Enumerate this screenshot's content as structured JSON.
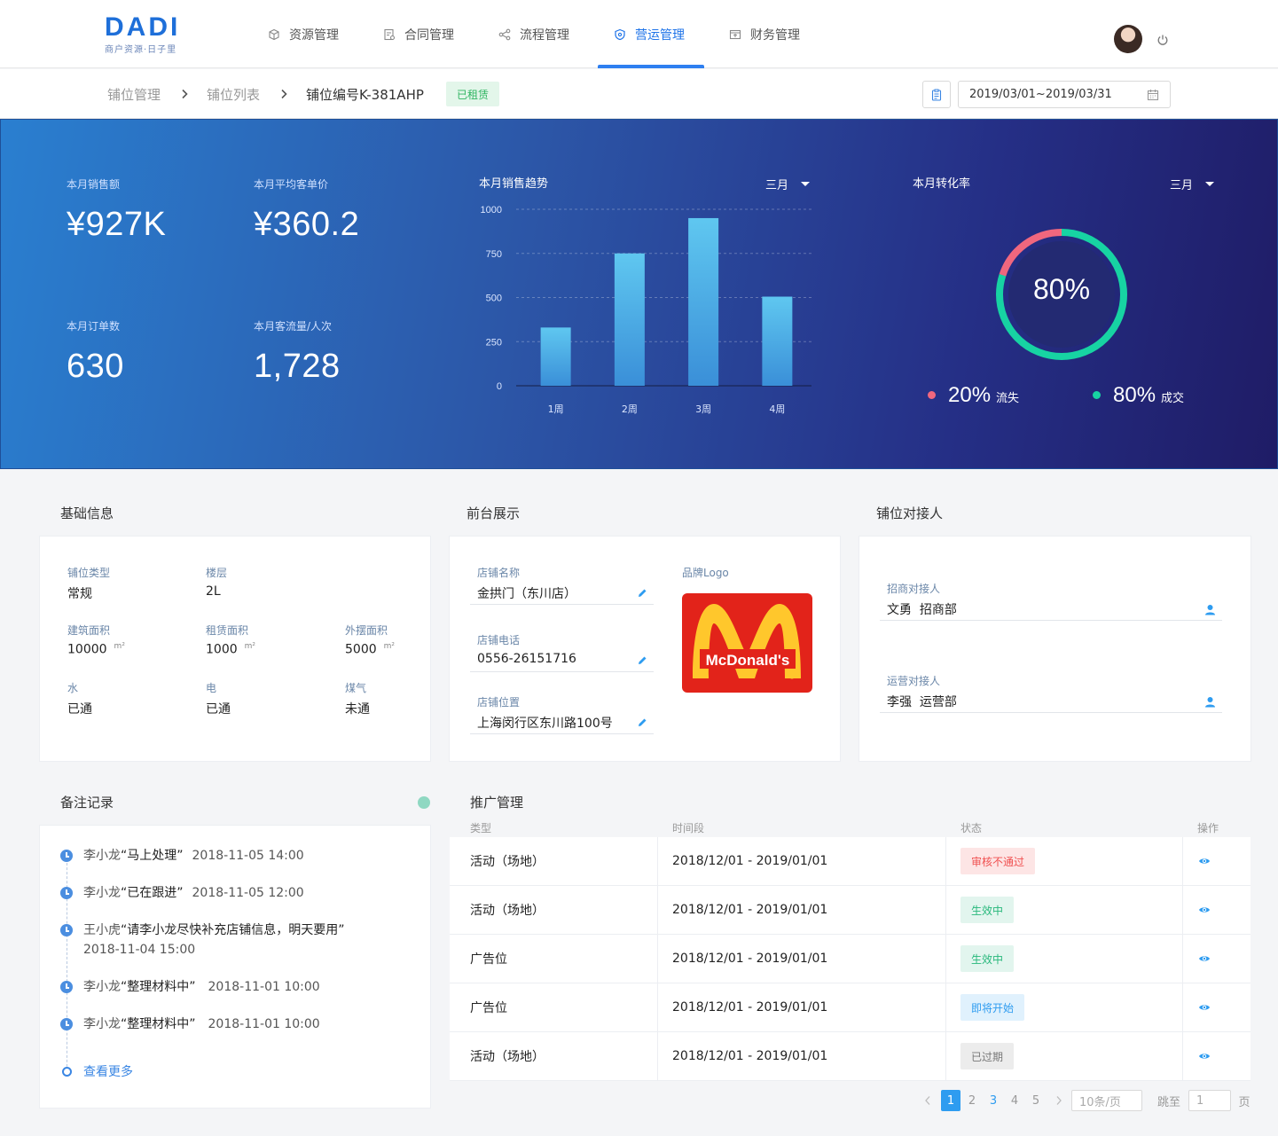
{
  "brand": {
    "logo": "DADI",
    "tagline": "商户资源·日子里"
  },
  "nav": {
    "items": [
      {
        "label": "资源管理",
        "icon": "box-icon"
      },
      {
        "label": "合同管理",
        "icon": "contract-icon"
      },
      {
        "label": "流程管理",
        "icon": "flow-icon"
      },
      {
        "label": "营运管理",
        "icon": "operations-icon",
        "active": true
      },
      {
        "label": "财务管理",
        "icon": "finance-icon"
      }
    ]
  },
  "breadcrumb": {
    "items": [
      "铺位管理",
      "铺位列表",
      "铺位编号K-381AHP"
    ],
    "status_tag": "已租赁"
  },
  "date_range": {
    "value": "2019/03/01~2019/03/31"
  },
  "kpis": [
    {
      "label": "本月销售额",
      "value": "¥927K"
    },
    {
      "label": "本月平均客单价",
      "value": "¥360.2"
    },
    {
      "label": "本月订单数",
      "value": "630"
    },
    {
      "label": "本月客流量/人次",
      "value": "1,728"
    }
  ],
  "sales_trend": {
    "title": "本月销售趋势",
    "period": "三月"
  },
  "conversion": {
    "title": "本月转化率",
    "period": "三月",
    "center_label": "80%",
    "legend": [
      {
        "pct": "20%",
        "name": "流失",
        "color": "#f0677e"
      },
      {
        "pct": "80%",
        "name": "成交",
        "color": "#17d3a3"
      }
    ],
    "value": 0.8
  },
  "chart_data": {
    "type": "bar",
    "categories": [
      "1周",
      "2周",
      "3周",
      "4周"
    ],
    "values": [
      330,
      750,
      950,
      505
    ],
    "ylim": [
      0,
      1000
    ],
    "yticks": [
      0,
      250,
      500,
      750,
      1000
    ],
    "grid": true
  },
  "basic_info": {
    "title": "基础信息",
    "fields": [
      {
        "label": "铺位类型",
        "value": "常规"
      },
      {
        "label": "楼层",
        "value": "2L"
      },
      {
        "label": "建筑面积",
        "value": "10000",
        "unit": "m²"
      },
      {
        "label": "租赁面积",
        "value": "1000",
        "unit": "m²"
      },
      {
        "label": "外摆面积",
        "value": "5000",
        "unit": "m²"
      },
      {
        "label": "水",
        "value": "已通"
      },
      {
        "label": "电",
        "value": "已通"
      },
      {
        "label": "煤气",
        "value": "未通"
      }
    ]
  },
  "storefront": {
    "title": "前台展示",
    "fields": [
      {
        "label": "店铺名称",
        "value": "金拱门（东川店）"
      },
      {
        "label": "店铺电话",
        "value": "0556-26151716"
      },
      {
        "label": "店铺位置",
        "value": "上海闵行区东川路100号"
      }
    ],
    "logo_label": "品牌Logo",
    "logo_text": "McDonald's"
  },
  "contacts": {
    "title": "铺位对接人",
    "fields": [
      {
        "label": "招商对接人",
        "value": "文勇  招商部"
      },
      {
        "label": "运营对接人",
        "value": "李强  运营部"
      }
    ]
  },
  "notes": {
    "title": "备注记录",
    "items": [
      {
        "who": "李小龙",
        "quote": "“马上处理”",
        "time": "2018-11-05 14:00"
      },
      {
        "who": "李小龙",
        "quote": "“已在跟进”",
        "time": "2018-11-05 12:00"
      },
      {
        "who": "王小虎",
        "quote": "“请李小龙尽快补充店铺信息，明天要用”",
        "time": "2018-11-04 15:00"
      },
      {
        "who": "李小龙",
        "quote": "“整理材料中”",
        "time": "2018-11-01 10:00"
      },
      {
        "who": "李小龙",
        "quote": "“整理材料中”",
        "time": "2018-11-01 10:00"
      }
    ],
    "more": "查看更多"
  },
  "promotion": {
    "title": "推广管理",
    "columns": [
      "类型",
      "时间段",
      "状态",
      "操作"
    ],
    "rows": [
      {
        "type": "活动（场地）",
        "period": "2018/12/01 - 2019/01/01",
        "status": "审核不通过",
        "status_kind": "rejected"
      },
      {
        "type": "活动（场地）",
        "period": "2018/12/01 - 2019/01/01",
        "status": "生效中",
        "status_kind": "active"
      },
      {
        "type": "广告位",
        "period": "2018/12/01 - 2019/01/01",
        "status": "生效中",
        "status_kind": "active"
      },
      {
        "type": "广告位",
        "period": "2018/12/01 - 2019/01/01",
        "status": "即将开始",
        "status_kind": "upcoming"
      },
      {
        "type": "活动（场地）",
        "period": "2018/12/01 - 2019/01/01",
        "status": "已过期",
        "status_kind": "expired"
      }
    ]
  },
  "pagination": {
    "pages": [
      "1",
      "2",
      "3",
      "4",
      "5"
    ],
    "current": "1",
    "page_size": "10条/页",
    "jump_label": "跳至",
    "jump_value": "1",
    "page_suffix": "页"
  }
}
